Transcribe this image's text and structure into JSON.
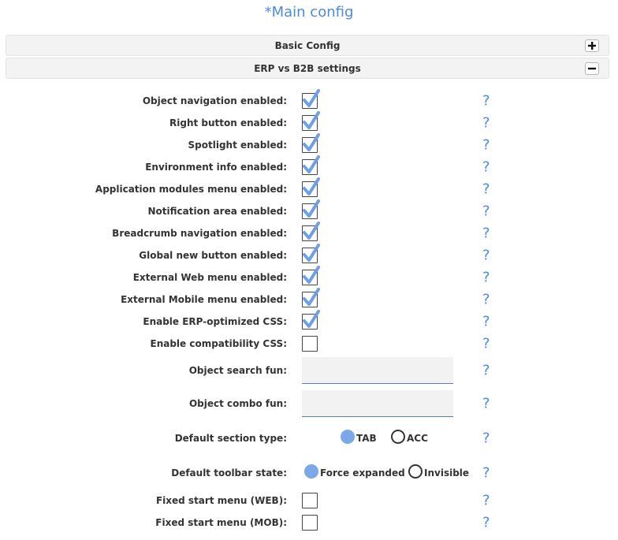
{
  "title": "*Main config",
  "sections": [
    {
      "label": "Basic Config",
      "toggle": "+"
    },
    {
      "label": "ERP vs B2B settings",
      "toggle": "−"
    }
  ],
  "checkbox_rows": [
    {
      "label": "Object navigation enabled:",
      "checked": true
    },
    {
      "label": "Right button enabled:",
      "checked": true
    },
    {
      "label": "Spotlight enabled:",
      "checked": true
    },
    {
      "label": "Environment info enabled:",
      "checked": true
    },
    {
      "label": "Application modules menu enabled:",
      "checked": true
    },
    {
      "label": "Notification area enabled:",
      "checked": true
    },
    {
      "label": "Breadcrumb navigation enabled:",
      "checked": true
    },
    {
      "label": "Global new button enabled:",
      "checked": true
    },
    {
      "label": "External Web menu enabled:",
      "checked": true
    },
    {
      "label": "External Mobile menu enabled:",
      "checked": true
    },
    {
      "label": "Enable ERP-optimized CSS:",
      "checked": true
    },
    {
      "label": "Enable compatibility CSS:",
      "checked": false
    }
  ],
  "text_fields": [
    {
      "label": "Object search fun:",
      "value": "",
      "placeholder": ""
    },
    {
      "label": "Object combo fun:",
      "value": "",
      "placeholder": ""
    }
  ],
  "radio_rows": [
    {
      "label": "Default section type:",
      "options": [
        {
          "label": "TAB",
          "selected": true
        },
        {
          "label": "ACC",
          "selected": false
        }
      ]
    },
    {
      "label": "Default toolbar state:",
      "options": [
        {
          "label": "Force expanded",
          "selected": true
        },
        {
          "label": "Invisible",
          "selected": false
        }
      ]
    }
  ],
  "bottom_rows": [
    {
      "label": "Fixed start menu (WEB):",
      "checked": false
    },
    {
      "label": "Fixed start menu (MOB):",
      "checked": false
    }
  ],
  "help_glyph": "?",
  "colors": {
    "accent": "#4a8be0",
    "radio_selected": "#7aa8e8",
    "check": "#6f9fe6"
  }
}
